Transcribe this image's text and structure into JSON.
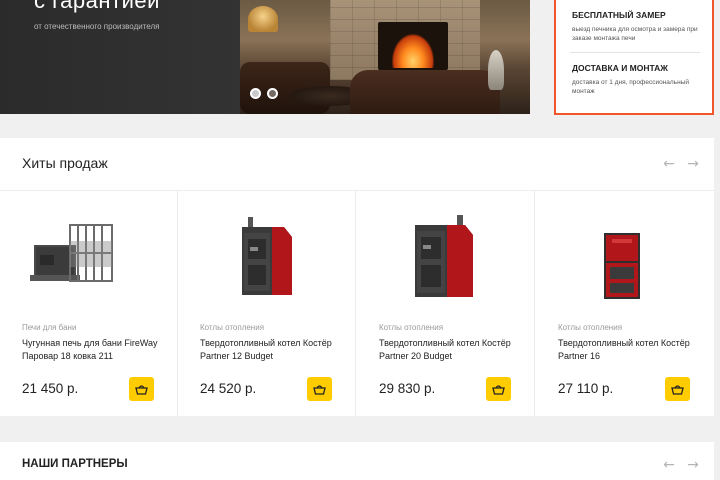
{
  "hero": {
    "title": "с гарантией",
    "subtitle": "от отечественного производителя",
    "slides": [
      {
        "active": true
      },
      {
        "active": false
      }
    ]
  },
  "services": [
    {
      "title": "БЕСПЛАТНЫЙ ЗАМЕР",
      "desc": "выезд печника для осмотра и замера при заказе монтажа печи"
    },
    {
      "title": "ДОСТАВКА И МОНТАЖ",
      "desc": "доставка от 1 дня, профессиональный монтаж"
    }
  ],
  "bestsellers": {
    "title": "Хиты продаж",
    "prev_icon": "arrow-left-icon",
    "next_icon": "arrow-right-icon",
    "products": [
      {
        "category": "Печи для бани",
        "name": "Чугунная печь для бани FireWay Паровар 18 ковка 211",
        "price": "21 450 р.",
        "image": "sauna-stove"
      },
      {
        "category": "Котлы отопления",
        "name": "Твердотопливный котел Костёр Partner 12 Budget",
        "price": "24 520 р.",
        "image": "boiler"
      },
      {
        "category": "Котлы отопления",
        "name": "Твердотопливный котел Костёр Partner 20 Budget",
        "price": "29 830 р.",
        "image": "boiler"
      },
      {
        "category": "Котлы отопления",
        "name": "Твердотопливный котел Костёр Partner 16",
        "price": "27 110 р.",
        "image": "boiler-narrow"
      }
    ]
  },
  "partners": {
    "title": "НАШИ ПАРТНЕРЫ"
  },
  "colors": {
    "accent": "#ffcc00",
    "services_border": "#f0552b",
    "boiler_red": "#b0161a",
    "boiler_dark": "#3a3a3a"
  }
}
